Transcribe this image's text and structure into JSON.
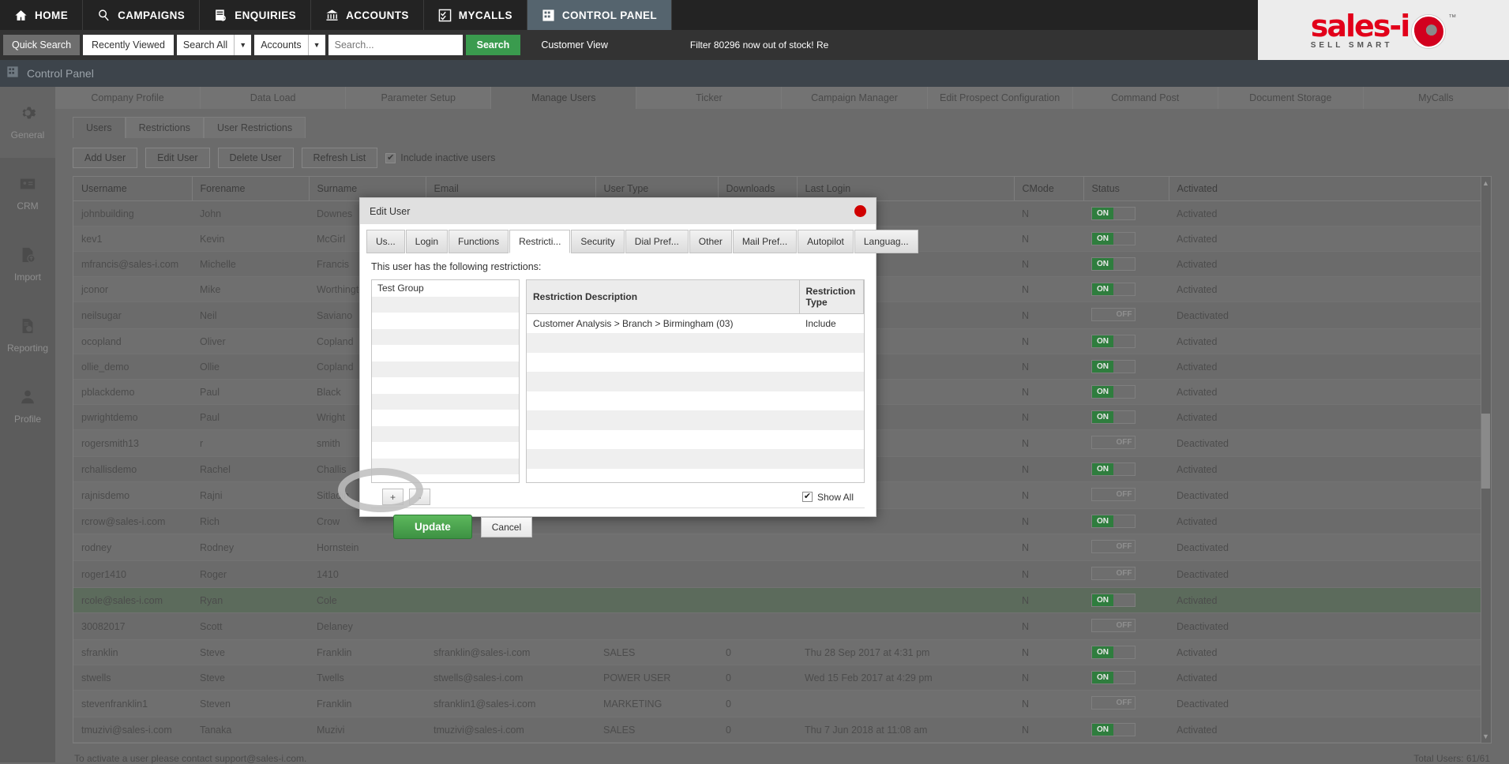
{
  "topnav": {
    "items": [
      {
        "label": "HOME",
        "icon": "home-icon",
        "active": false
      },
      {
        "label": "CAMPAIGNS",
        "icon": "campaigns-icon",
        "active": false
      },
      {
        "label": "ENQUIRIES",
        "icon": "enquiries-icon",
        "active": false
      },
      {
        "label": "ACCOUNTS",
        "icon": "accounts-icon",
        "active": false
      },
      {
        "label": "MYCALLS",
        "icon": "mycalls-icon",
        "active": false
      },
      {
        "label": "CONTROL PANEL",
        "icon": "control-panel-icon",
        "active": true
      }
    ],
    "help_icon": "?",
    "user_icon": "user-icon",
    "logout_icon": "→"
  },
  "brand": {
    "name": "sales-i",
    "tagline": "SELL SMART",
    "tm": "™"
  },
  "search": {
    "quick_search": "Quick Search",
    "recently_viewed": "Recently Viewed",
    "scope": "Search All",
    "entity": "Accounts",
    "placeholder": "Search...",
    "button": "Search",
    "customer_view": "Customer View",
    "ticker": "Filter 80296 now out of stock! Re"
  },
  "breadcrumb": {
    "title": "Control Panel",
    "icon": "control-panel-icon"
  },
  "sidebar": {
    "items": [
      {
        "label": "General",
        "icon": "gear-icon",
        "active": true
      },
      {
        "label": "CRM",
        "icon": "contact-card-icon",
        "active": false
      },
      {
        "label": "Import",
        "icon": "file-upload-icon",
        "active": false
      },
      {
        "label": "Reporting",
        "icon": "report-icon",
        "active": false
      },
      {
        "label": "Profile",
        "icon": "person-icon",
        "active": false
      }
    ]
  },
  "main_tabs": [
    {
      "label": "Company Profile",
      "active": false
    },
    {
      "label": "Data Load",
      "active": false
    },
    {
      "label": "Parameter Setup",
      "active": false
    },
    {
      "label": "Manage Users",
      "active": true
    },
    {
      "label": "Ticker",
      "active": false
    },
    {
      "label": "Campaign Manager",
      "active": false
    },
    {
      "label": "Edit Prospect Configuration",
      "active": false
    },
    {
      "label": "Command Post",
      "active": false
    },
    {
      "label": "Document Storage",
      "active": false
    },
    {
      "label": "MyCalls",
      "active": false
    }
  ],
  "sub_tabs": [
    {
      "label": "Users",
      "active": true
    },
    {
      "label": "Restrictions",
      "active": false
    },
    {
      "label": "User Restrictions",
      "active": false
    }
  ],
  "toolbar": {
    "add_user": "Add User",
    "edit_user": "Edit User",
    "delete_user": "Delete User",
    "refresh_list": "Refresh List",
    "include_inactive_label": "Include inactive users",
    "include_inactive_checked": true,
    "check_glyph": "✔"
  },
  "users_table": {
    "columns": [
      "Username",
      "Forename",
      "Surname",
      "Email",
      "User Type",
      "Downloads",
      "Last Login",
      "CMode",
      "Status",
      "Activated"
    ],
    "rows": [
      {
        "username": "johnbuilding",
        "forename": "John",
        "surname": "Downes",
        "email": "",
        "usertype": "",
        "downloads": "",
        "lastlogin": "",
        "cmode": "N",
        "status": "ON",
        "activated": "Activated"
      },
      {
        "username": "kev1",
        "forename": "Kevin",
        "surname": "McGirl",
        "email": "",
        "usertype": "",
        "downloads": "",
        "lastlogin": "",
        "cmode": "N",
        "status": "ON",
        "activated": "Activated"
      },
      {
        "username": "mfrancis@sales-i.com",
        "forename": "Michelle",
        "surname": "Francis",
        "email": "",
        "usertype": "",
        "downloads": "",
        "lastlogin": "",
        "cmode": "N",
        "status": "ON",
        "activated": "Activated"
      },
      {
        "username": "jconor",
        "forename": "Mike",
        "surname": "Worthington",
        "email": "",
        "usertype": "",
        "downloads": "",
        "lastlogin": "",
        "cmode": "N",
        "status": "ON",
        "activated": "Activated"
      },
      {
        "username": "neilsugar",
        "forename": "Neil",
        "surname": "Saviano",
        "email": "",
        "usertype": "",
        "downloads": "",
        "lastlogin": "",
        "cmode": "N",
        "status": "OFF",
        "activated": "Deactivated"
      },
      {
        "username": "ocopland",
        "forename": "Oliver",
        "surname": "Copland",
        "email": "",
        "usertype": "",
        "downloads": "",
        "lastlogin": "",
        "cmode": "N",
        "status": "ON",
        "activated": "Activated"
      },
      {
        "username": "ollie_demo",
        "forename": "Ollie",
        "surname": "Copland",
        "email": "",
        "usertype": "",
        "downloads": "",
        "lastlogin": "",
        "cmode": "N",
        "status": "ON",
        "activated": "Activated"
      },
      {
        "username": "pblackdemo",
        "forename": "Paul",
        "surname": "Black",
        "email": "",
        "usertype": "",
        "downloads": "",
        "lastlogin": "",
        "cmode": "N",
        "status": "ON",
        "activated": "Activated"
      },
      {
        "username": "pwrightdemo",
        "forename": "Paul",
        "surname": "Wright",
        "email": "",
        "usertype": "",
        "downloads": "",
        "lastlogin": "",
        "cmode": "N",
        "status": "ON",
        "activated": "Activated"
      },
      {
        "username": "rogersmith13",
        "forename": "r",
        "surname": "smith",
        "email": "",
        "usertype": "",
        "downloads": "",
        "lastlogin": "",
        "cmode": "N",
        "status": "OFF",
        "activated": "Deactivated"
      },
      {
        "username": "rchallisdemo",
        "forename": "Rachel",
        "surname": "Challis",
        "email": "",
        "usertype": "",
        "downloads": "",
        "lastlogin": "",
        "cmode": "N",
        "status": "ON",
        "activated": "Activated"
      },
      {
        "username": "rajnisdemo",
        "forename": "Rajni",
        "surname": "Sitladin",
        "email": "",
        "usertype": "",
        "downloads": "",
        "lastlogin": "",
        "cmode": "N",
        "status": "OFF",
        "activated": "Deactivated"
      },
      {
        "username": "rcrow@sales-i.com",
        "forename": "Rich",
        "surname": "Crow",
        "email": "",
        "usertype": "",
        "downloads": "",
        "lastlogin": "",
        "cmode": "N",
        "status": "ON",
        "activated": "Activated"
      },
      {
        "username": "rodney",
        "forename": "Rodney",
        "surname": "Hornstein",
        "email": "",
        "usertype": "",
        "downloads": "",
        "lastlogin": "",
        "cmode": "N",
        "status": "OFF",
        "activated": "Deactivated"
      },
      {
        "username": "roger1410",
        "forename": "Roger",
        "surname": "1410",
        "email": "",
        "usertype": "",
        "downloads": "",
        "lastlogin": "",
        "cmode": "N",
        "status": "OFF",
        "activated": "Deactivated"
      },
      {
        "username": "rcole@sales-i.com",
        "forename": "Ryan",
        "surname": "Cole",
        "email": "",
        "usertype": "",
        "downloads": "",
        "lastlogin": "",
        "cmode": "N",
        "status": "ON",
        "activated": "Activated",
        "selected": true
      },
      {
        "username": "30082017",
        "forename": "Scott",
        "surname": "Delaney",
        "email": "",
        "usertype": "",
        "downloads": "",
        "lastlogin": "",
        "cmode": "N",
        "status": "OFF",
        "activated": "Deactivated"
      },
      {
        "username": "sfranklin",
        "forename": "Steve",
        "surname": "Franklin",
        "email": "sfranklin@sales-i.com",
        "usertype": "SALES",
        "downloads": "0",
        "lastlogin": "Thu 28 Sep 2017 at 4:31 pm",
        "cmode": "N",
        "status": "ON",
        "activated": "Activated"
      },
      {
        "username": "stwells",
        "forename": "Steve",
        "surname": "Twells",
        "email": "stwells@sales-i.com",
        "usertype": "POWER USER",
        "downloads": "0",
        "lastlogin": "Wed 15 Feb 2017 at 4:29 pm",
        "cmode": "N",
        "status": "ON",
        "activated": "Activated"
      },
      {
        "username": "stevenfranklin1",
        "forename": "Steven",
        "surname": "Franklin",
        "email": "sfranklin1@sales-i.com",
        "usertype": "MARKETING",
        "downloads": "0",
        "lastlogin": "",
        "cmode": "N",
        "status": "OFF",
        "activated": "Deactivated"
      },
      {
        "username": "tmuzivi@sales-i.com",
        "forename": "Tanaka",
        "surname": "Muzivi",
        "email": "tmuzivi@sales-i.com",
        "usertype": "SALES",
        "downloads": "0",
        "lastlogin": "Thu 7 Jun 2018 at 11:08 am",
        "cmode": "N",
        "status": "ON",
        "activated": "Activated"
      }
    ]
  },
  "footer": {
    "note": "To activate a user please contact support@sales-i.com.",
    "total": "Total Users: 61/61"
  },
  "modal": {
    "title": "Edit User",
    "close_icon": "close-icon",
    "tabs": [
      {
        "label": "Us...",
        "active": false
      },
      {
        "label": "Login",
        "active": false
      },
      {
        "label": "Functions",
        "active": false
      },
      {
        "label": "Restricti...",
        "active": true
      },
      {
        "label": "Security",
        "active": false
      },
      {
        "label": "Dial Pref...",
        "active": false
      },
      {
        "label": "Other",
        "active": false
      },
      {
        "label": "Mail Pref...",
        "active": false
      },
      {
        "label": "Autopilot",
        "active": false
      },
      {
        "label": "Languag...",
        "active": false
      }
    ],
    "intro": "This user has the following restrictions:",
    "groups": [
      "Test Group",
      "",
      "",
      "",
      "",
      "",
      "",
      "",
      "",
      "",
      "",
      "",
      ""
    ],
    "restriction_columns": [
      "Restriction Description",
      "Restriction Type"
    ],
    "restrictions": [
      {
        "description": "Customer Analysis > Branch > Birmingham (03)",
        "type": "Include"
      },
      {
        "description": "",
        "type": ""
      },
      {
        "description": "",
        "type": ""
      },
      {
        "description": "",
        "type": ""
      },
      {
        "description": "",
        "type": ""
      },
      {
        "description": "",
        "type": ""
      },
      {
        "description": "",
        "type": ""
      },
      {
        "description": "",
        "type": ""
      },
      {
        "description": "",
        "type": ""
      }
    ],
    "add_button": "+",
    "remove_button": "-",
    "show_all_label": "Show All",
    "show_all_checked": true,
    "check_glyph": "✔",
    "update_button": "Update",
    "cancel_button": "Cancel"
  },
  "colors": {
    "brand_red": "#e2001a",
    "accent_green": "#3a9b4e",
    "nav_dark": "#232323",
    "active_tab": "#55646e",
    "selected_row": "#5c6b5c"
  }
}
